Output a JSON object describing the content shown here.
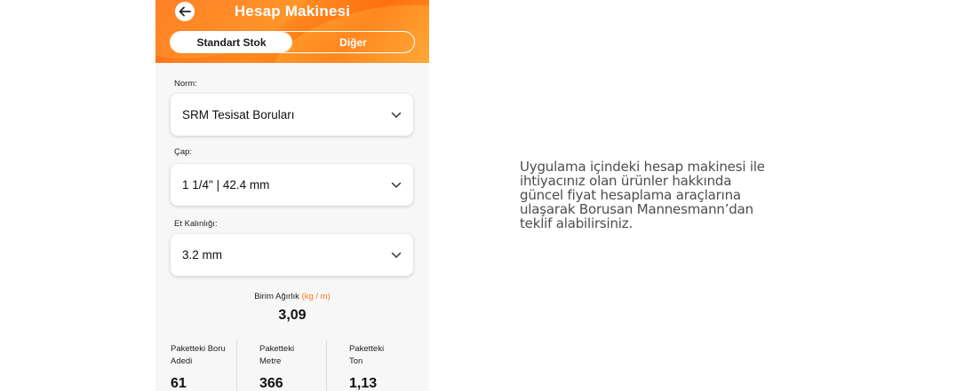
{
  "header": {
    "title": "Hesap Makinesi",
    "tabs": [
      {
        "label": "Standart Stok",
        "active": true
      },
      {
        "label": "Diğer",
        "active": false
      }
    ]
  },
  "form": {
    "norm": {
      "label": "Norm:",
      "value": "SRM Tesisat Boruları"
    },
    "cap": {
      "label": "Çap:",
      "value": "1 1/4\" | 42.4 mm"
    },
    "et": {
      "label": "Et Kalınlığı:",
      "value": "3.2 mm"
    }
  },
  "unit_weight": {
    "label": "Birim Ağırlık",
    "unit": "(kg / m)",
    "value": "3,09"
  },
  "stats": [
    {
      "label": "Paketteki Boru\nAdedi",
      "value": "61"
    },
    {
      "label": "Paketteki\nMetre",
      "value": "366"
    },
    {
      "label": "Paketteki\nTon",
      "value": "1,13"
    }
  ],
  "description": "Uygulama içindeki hesap makinesi ile ihtiyacınız olan ürünler hakkında güncel fiyat hesaplama araçlarına ulaşarak Borusan Mannesmann’dan teklif alabilirsiniz.",
  "colors": {
    "accent": "#ff7a1a",
    "text": "#111111"
  }
}
